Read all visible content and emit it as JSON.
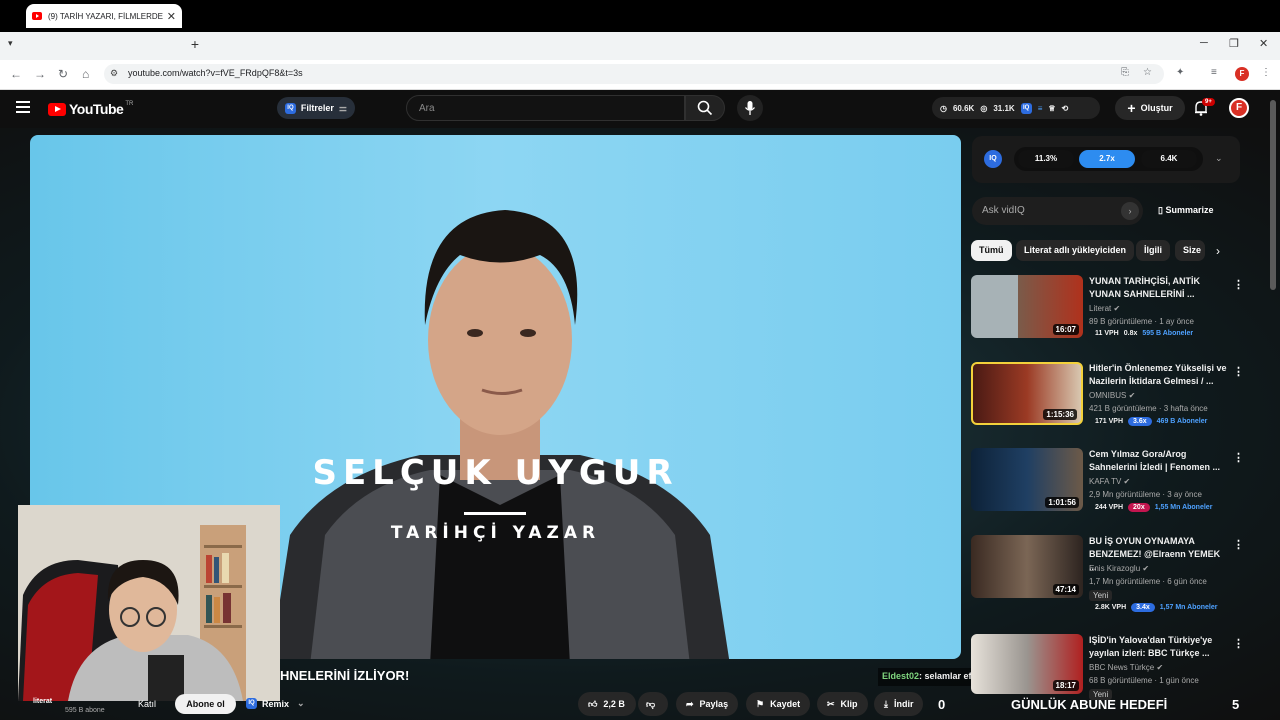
{
  "browser": {
    "tab_title": "(9) TARİH YAZARI, FİLMLERDEK",
    "url": "youtube.com/watch?v=fVE_FRdpQF8&t=3s"
  },
  "header": {
    "logo": "YouTube",
    "country": "TR",
    "filters_label": "Filtreler",
    "search_placeholder": "Ara",
    "stat_views": "60.6K",
    "stat_subs": "31.1K",
    "create_label": "Oluştur",
    "notif_count": "9+",
    "avatar_letter": "F"
  },
  "video": {
    "title_overlay": "SELÇUK UYGUR",
    "subtitle_overlay": "TARİHÇİ YAZAR",
    "caption": "HNELERİNİ İZLİYOR!",
    "chat_user": "Eldest02",
    "chat_text": ": selamlar efenim"
  },
  "actions": {
    "channel_name": "literat",
    "channel_subs": "595 B abone",
    "join_label": "Katıl",
    "subscribe_label": "Abone ol",
    "remix_label": "Remix",
    "like_count": "2,2 B",
    "share_label": "Paylaş",
    "save_label": "Kaydet",
    "clip_label": "Klip",
    "download_label": "İndir",
    "goal_count": "0",
    "goal_label": "GÜNLÜK ABUNE HEDEFİ",
    "goal_target": "5"
  },
  "vidiq": {
    "logo": "IQ",
    "pill1": "11.3%",
    "pill2": "2.7x",
    "pill3": "6.4K",
    "ask_placeholder": "Ask vidIQ",
    "summarize_label": "Summarize"
  },
  "chips": [
    "Tümü",
    "Literat adlı yükleyiciden",
    "İlgili",
    "Size"
  ],
  "recommendations": [
    {
      "title": "YUNAN TARİHÇİSİ, ANTİK YUNAN SAHNELERİNİ ...",
      "channel": "Literat",
      "meta": "89 B görüntüleme · 1 ay önce",
      "duration": "16:07",
      "vph": "11 VPH",
      "mult": "0.8x",
      "subs": "595 B Aboneler"
    },
    {
      "title": "Hitler'in Önlenemez Yükselişi ve Nazilerin İktidara Gelmesi / ...",
      "channel": "OMNIBUS",
      "meta": "421 B görüntüleme · 3 hafta önce",
      "duration": "1:15:36",
      "vph": "171 VPH",
      "mult": "3.6x",
      "subs": "469 B Aboneler"
    },
    {
      "title": "Cem Yılmaz Gora/Arog Sahnelerini İzledi | Fenomen ...",
      "channel": "KAFA TV",
      "meta": "2,9 Mn görüntüleme · 3 ay önce",
      "duration": "1:01:56",
      "vph": "244 VPH",
      "mult": "20x",
      "subs": "1,55 Mn Aboneler"
    },
    {
      "title": "BU İŞ OYUN OYNAMAYA BENZEMEZ! @Elraenn YEMEK ...",
      "channel": "Enis Kirazoglu",
      "meta": "1,7 Mn görüntüleme · 6 gün önce",
      "badge": "Yeni",
      "duration": "47:14",
      "vph": "2.8K VPH",
      "mult": "3.4x",
      "subs": "1,57 Mn Aboneler"
    },
    {
      "title": "IŞİD'in Yalova'dan Türkiye'ye yayılan izleri: BBC Türkçe ...",
      "channel": "BBC News Türkçe",
      "meta": "68 B görüntüleme · 1 gün önce",
      "badge": "Yeni",
      "duration": "18:17"
    }
  ]
}
